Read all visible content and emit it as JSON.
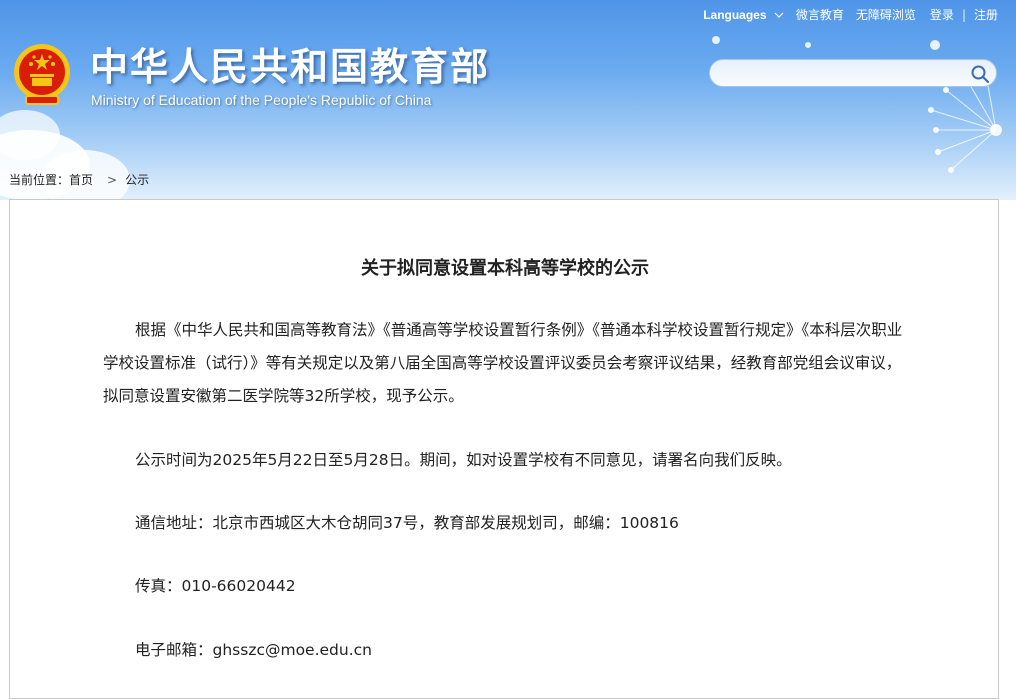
{
  "header": {
    "title_cn": "中华人民共和国教育部",
    "title_en": "Ministry of Education of the People's Republic of China",
    "topnav": {
      "languages": "Languages",
      "weiyan": "微言教育",
      "accessible": "无障碍浏览",
      "login": "登录",
      "separator": "|",
      "register": "注册"
    },
    "search": {
      "placeholder": ""
    }
  },
  "breadcrumb": {
    "prefix": "当前位置：",
    "home": "首页",
    "chevron": ">",
    "current": "公示"
  },
  "article": {
    "title": "关于拟同意设置本科高等学校的公示",
    "paragraphs": [
      "根据《中华人民共和国高等教育法》《普通高等学校设置暂行条例》《普通本科学校设置暂行规定》《本科层次职业学校设置标准（试行）》等有关规定以及第八届全国高等学校设置评议委员会考察评议结果，经教育部党组会议审议，拟同意设置安徽第二医学院等32所学校，现予公示。",
      "公示时间为2025年5月22日至5月28日。期间，如对设置学校有不同意见，请署名向我们反映。",
      "通信地址：北京市西城区大木仓胡同37号，教育部发展规划司，邮编：100816",
      "传真：010-66020442",
      "电子邮箱：ghsszc@moe.edu.cn"
    ]
  },
  "colors": {
    "header_top": "#4f95e8",
    "header_bottom": "#e3f0fc",
    "emblem_red": "#d81e06",
    "emblem_gold": "#f5c518"
  },
  "icons": [
    "national-emblem-icon",
    "chevron-down-icon",
    "search-icon"
  ]
}
